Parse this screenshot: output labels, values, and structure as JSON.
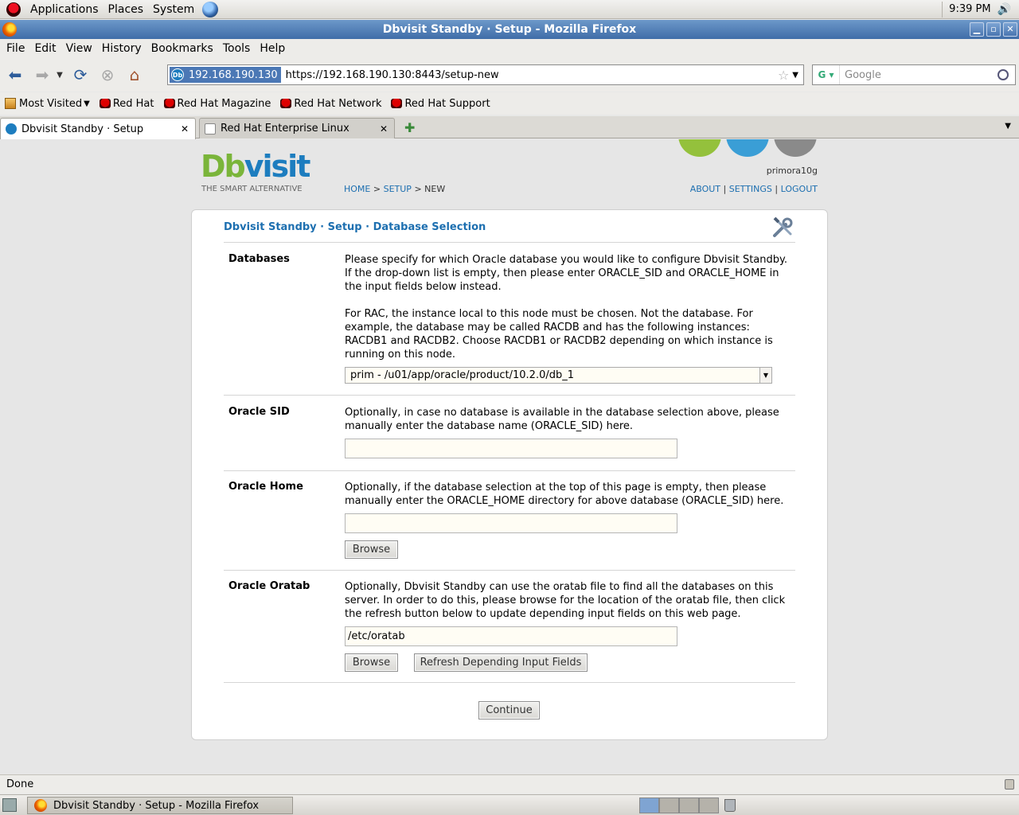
{
  "panel": {
    "menus": [
      "Applications",
      "Places",
      "System"
    ],
    "clock": "9:39 PM"
  },
  "window": {
    "title": "Dbvisit Standby · Setup - Mozilla Firefox"
  },
  "menubar": {
    "items": [
      "File",
      "Edit",
      "View",
      "History",
      "Bookmarks",
      "Tools",
      "Help"
    ]
  },
  "navbar": {
    "site_identity": "192.168.190.130",
    "url": "https://192.168.190.130:8443/setup-new",
    "search_placeholder": "Google"
  },
  "bookmarks": {
    "items": [
      "Most Visited",
      "Red Hat",
      "Red Hat Magazine",
      "Red Hat Network",
      "Red Hat Support"
    ]
  },
  "tabs": [
    {
      "label": "Dbvisit Standby · Setup",
      "active": true
    },
    {
      "label": "Red Hat Enterprise Linux",
      "active": false
    }
  ],
  "site": {
    "logo_primary": "Db",
    "logo_secondary": "visit",
    "tagline": "THE SMART ALTERNATIVE",
    "breadcrumb": {
      "home": "HOME",
      "sep": ">",
      "setup": "SETUP",
      "current": "NEW"
    },
    "username": "primora10g",
    "links": [
      "ABOUT",
      "SETTINGS",
      "LOGOUT"
    ],
    "link_sep": "|",
    "brand_colors": {
      "green": "#94c13c",
      "blue": "#3a9ed6",
      "gray": "#8a8a8a",
      "link": "#1d6fb0"
    }
  },
  "form": {
    "title": "Dbvisit Standby · Setup · Database Selection",
    "sections": {
      "databases": {
        "label": "Databases",
        "desc1": "Please specify for which Oracle database you would like to configure Dbvisit Standby. If the drop-down list is empty, then please enter ORACLE_SID and ORACLE_HOME in the input fields below instead.",
        "desc2": "For RAC, the instance local to this node must be chosen. Not the database. For example, the database may be called RACDB and has the following instances: RACDB1 and RACDB2. Choose RACDB1 or RACDB2 depending on which instance is running on this node.",
        "selected": "prim - /u01/app/oracle/product/10.2.0/db_1"
      },
      "sid": {
        "label": "Oracle SID",
        "desc": "Optionally, in case no database is available in the database selection above, please manually enter the database name (ORACLE_SID) here.",
        "value": ""
      },
      "home": {
        "label": "Oracle Home",
        "desc": "Optionally, if the database selection at the top of this page is empty, then please manually enter the ORACLE_HOME directory for above database (ORACLE_SID) here.",
        "value": "",
        "browse": "Browse"
      },
      "oratab": {
        "label": "Oracle Oratab",
        "desc": "Optionally, Dbvisit Standby can use the oratab file to find all the databases on this server. In order to do this, please browse for the location of the oratab file, then click the refresh button below to update depending input fields on this web page.",
        "value": "/etc/oratab",
        "browse": "Browse",
        "refresh": "Refresh Depending Input Fields"
      }
    },
    "continue": "Continue"
  },
  "statusbar": {
    "text": "Done"
  },
  "taskbar": {
    "window_label": "Dbvisit Standby · Setup - Mozilla Firefox"
  }
}
